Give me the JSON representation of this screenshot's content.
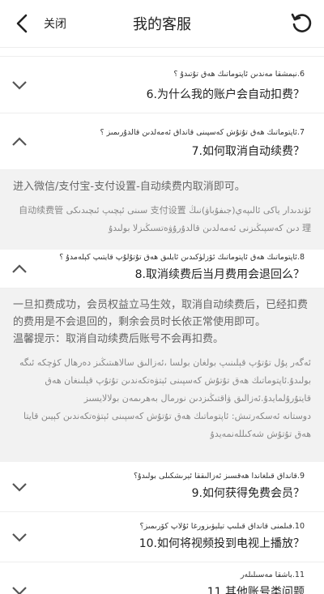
{
  "header": {
    "close_label": "关闭",
    "title": "我的客服"
  },
  "items": [
    {
      "zh": "6.为什么我的账户会自动扣费？",
      "ug": "6.نېمشقا مەندىن ئاپتوماتىك ھەق تۇتىدۇ ؟",
      "expanded": false
    },
    {
      "zh": "7.如何取消自动续费？",
      "ug": "7.ئاپتوماتىك ھەق تۇتۇش كەسپىنى قانداق ئەمەلدىن قالدۇرىمىز ؟",
      "expanded": true,
      "answer_zh": "进入微信/支付宝-支付设置-自动续费内取消即可。",
      "answer_ug": "ئۈندىدار ياكى ئالىپەي(جىفۇباۋ)نىڭ 支付设置 سىنى ئېچىپ ئىچىدىكى 自动续费管理 دىن كەسپىڭىزنى ئەمەلدىن قالدۇرۇۋەتسىڭىزلا بولىدۇ"
    },
    {
      "zh": "8.取消续费后当月费用会退回么？",
      "ug": "8.ئاپتوماتىك ھەق ئاپتوماتىك ئۆزلۈكىدىن ئايلىق ھەق تۇتۇلۇپ قايتىپ كېلەمدۇ ؟",
      "expanded": true,
      "answer_zh": "一旦扣费成功，会员权益立马生效，取消自动续费后，已经扣费的费用是不会退回的，剩余会员时长依正常使用即可。",
      "answer_tip": "温馨提示：取消自动续费后账号不会再扣费。",
      "answer_ug": "ئەگەر پۇل تۇتۇپ قېلىنىپ بولغان بولسا ،ئەزالىق سالاھىتىڭىز دەرھال كۈچكە ئىگە بولىدۇ.ئاپتوماتىك ھەق تۇتۇش كەسپىنى ئېتۋەتكەندىن تۇتۇپ قېلىنغان ھەق قايتۇرۇلمايدۇ.ئەزالىق ۋاقتىڭىزدىن نورمال بەھرىمەن بولالايسىز",
      "answer_ug_tip": "دوستانە ئەسكەرتىش: ئاپتوماتىك ھەق تۇتۇش كەسپىنى ئېتۋەتكەندىن كېيىن قايتا ھەق تۇتۇش شەكىللەنمەيدۇ"
    },
    {
      "zh": "9.如何获得免费会员？",
      "ug": "9.قانداق قىلغاندا ھەقسىز ئەزالىققا ئېرىشكىلى بولىدۇ؟",
      "expanded": false
    },
    {
      "zh": "10.如何将视频投到电视上播放？",
      "ug": "10.فىلمنى قانداق قىلىپ تېلېۋىزورغا ئۇلاپ كۆرىمىز؟",
      "expanded": false
    },
    {
      "zh": "11.其他账号类问题",
      "ug": "11.باشقا مەسىلىلەر",
      "expanded": false
    }
  ]
}
